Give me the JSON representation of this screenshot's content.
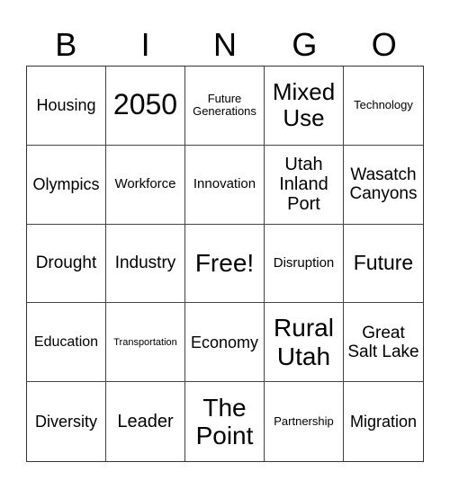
{
  "header": {
    "letters": [
      "B",
      "I",
      "N",
      "G",
      "O"
    ]
  },
  "cells": [
    "Housing",
    "2050",
    "Future Generations",
    "Mixed Use",
    "Technology",
    "Olympics",
    "Workforce",
    "Innovation",
    "Utah Inland Port",
    "Wasatch Canyons",
    "Drought",
    "Industry",
    "Free!",
    "Disruption",
    "Future",
    "Education",
    "Transportation",
    "Economy",
    "Rural Utah",
    "Great Salt Lake",
    "Diversity",
    "Leader",
    "The Point",
    "Partnership",
    "Migration"
  ]
}
